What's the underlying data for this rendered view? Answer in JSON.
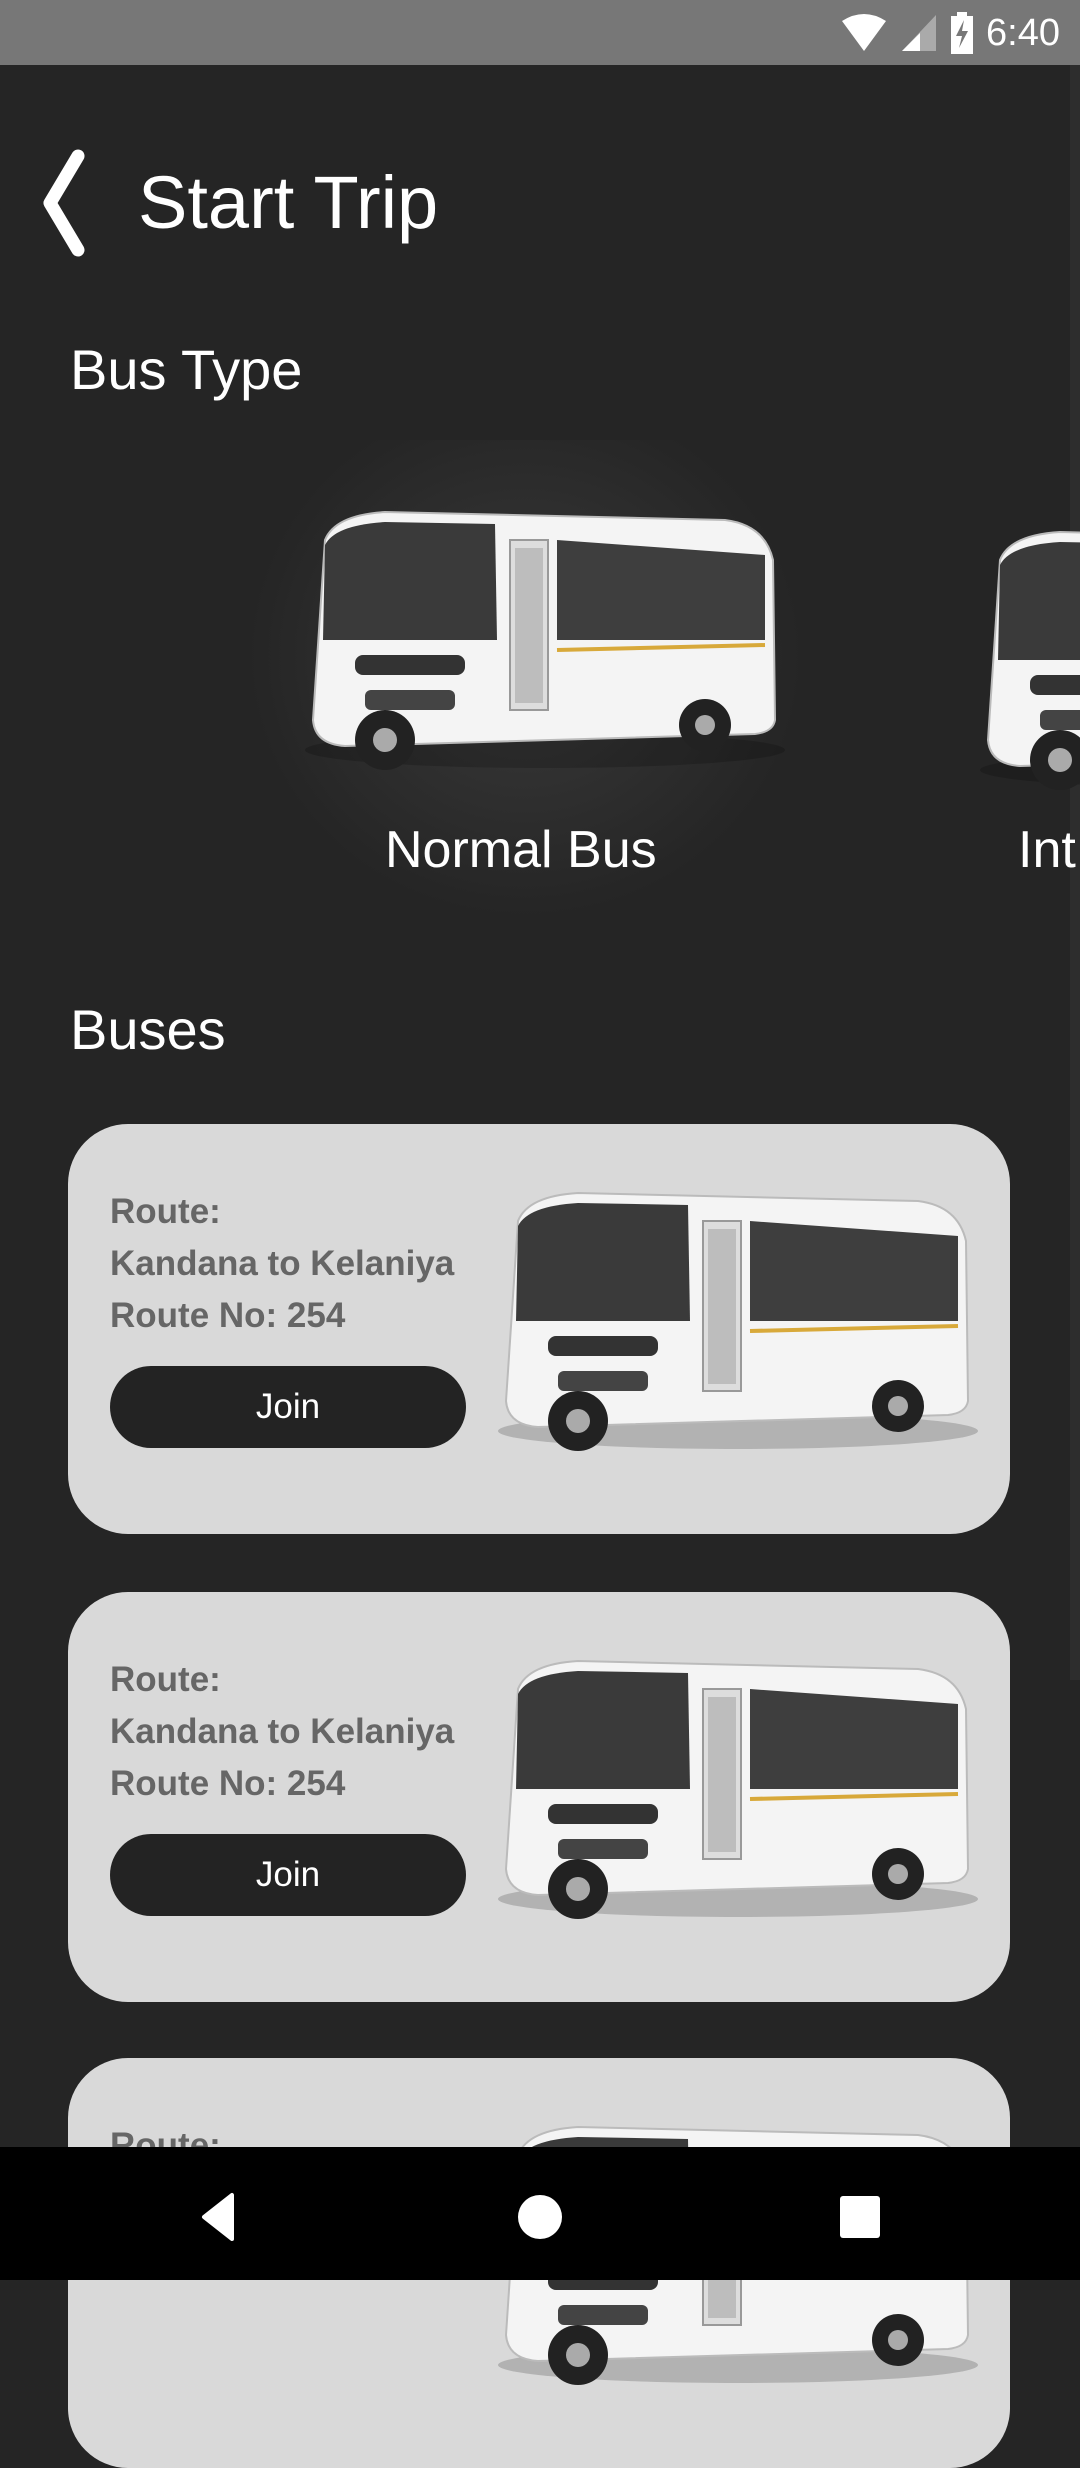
{
  "status_bar": {
    "time": "6:40",
    "icons": [
      "wifi-icon",
      "signal-icon",
      "battery-charging-icon"
    ]
  },
  "header": {
    "title": "Start Trip",
    "back_icon": "chevron-left-icon"
  },
  "bus_type": {
    "heading": "Bus Type",
    "items": [
      {
        "label": "Normal Bus"
      },
      {
        "label": "Int"
      }
    ]
  },
  "buses": {
    "heading": "Buses",
    "cards": [
      {
        "route_label": "Route:",
        "route": "Kandana to Kelaniya",
        "route_no": "Route No: 254",
        "button": "Join"
      },
      {
        "route_label": "Route:",
        "route": "Kandana to Kelaniya",
        "route_no": "Route No: 254",
        "button": "Join"
      },
      {
        "route_label": "Route:"
      }
    ]
  },
  "nav_bar": {
    "icons": [
      "back-icon",
      "home-icon",
      "recents-icon"
    ]
  },
  "colors": {
    "background": "#252525",
    "card": "#d9d9d9",
    "button": "#232323",
    "status_bar": "#777777",
    "card_text": "#666666"
  }
}
